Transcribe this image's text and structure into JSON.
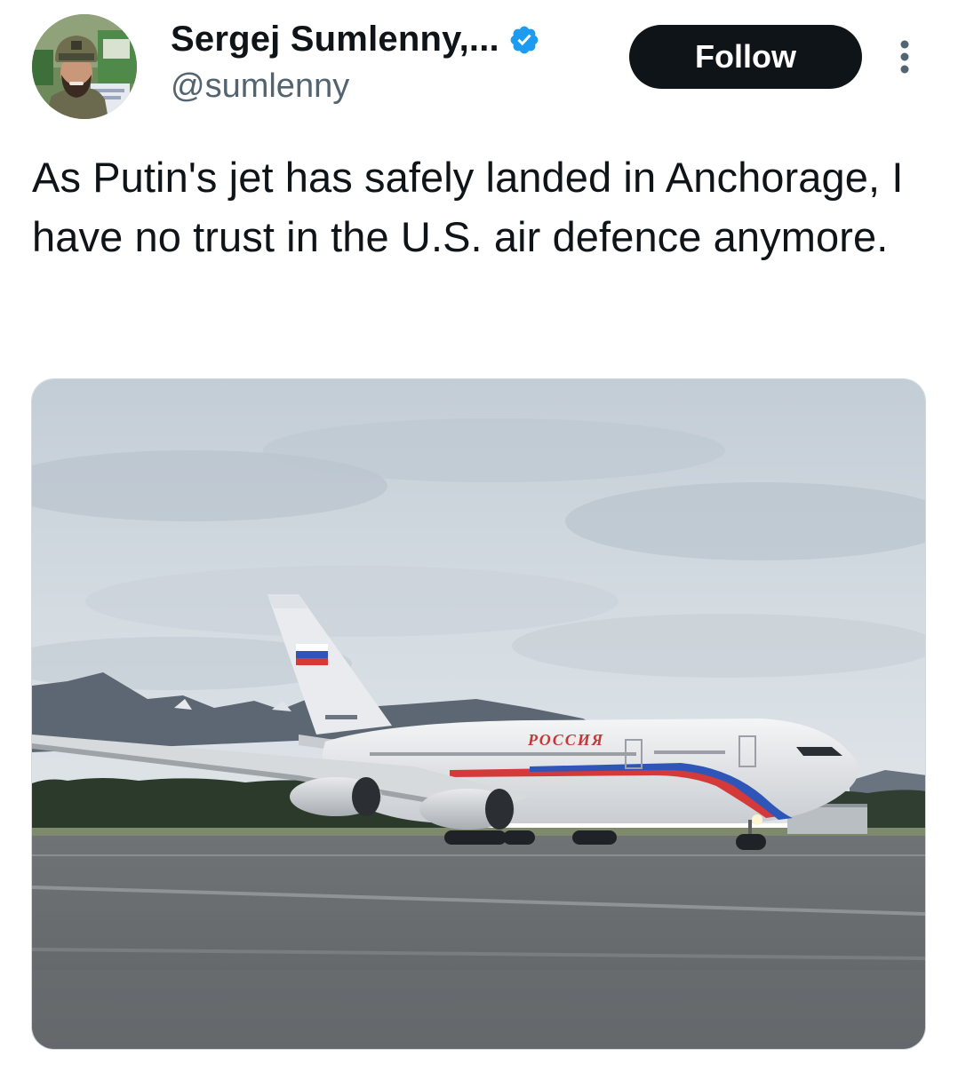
{
  "author": {
    "display_name": "Sergej Sumlenny,...",
    "handle": "@sumlenny",
    "verified": true,
    "verified_icon": "verified-badge-icon",
    "verified_color": "#1d9bf0"
  },
  "actions": {
    "follow_label": "Follow",
    "more_icon": "more-vertical-icon"
  },
  "tweet": {
    "text": "As Putin's jet has safely landed in Anchorage, I have no trust in the U.S. air defence anymore."
  },
  "media": {
    "fuselage_text": "РОССИЯ"
  },
  "colors": {
    "text_primary": "#0f1419",
    "text_secondary": "#536471",
    "follow_bg": "#0f1419",
    "follow_text": "#ffffff"
  }
}
